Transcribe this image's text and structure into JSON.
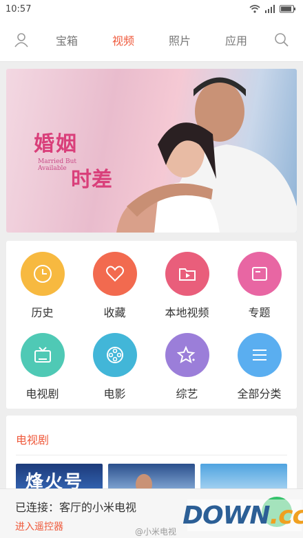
{
  "status_bar": {
    "time": "10:57",
    "icons": [
      "wifi-icon",
      "signal-icon",
      "battery-icon"
    ]
  },
  "top_nav": {
    "tabs": [
      {
        "label": "宝箱",
        "active": false
      },
      {
        "label": "视频",
        "active": true
      },
      {
        "label": "照片",
        "active": false
      },
      {
        "label": "应用",
        "active": false
      }
    ],
    "left_icon": "user-icon",
    "right_icon": "search-icon",
    "active_color": "#ef5a3c"
  },
  "banner": {
    "title_cn_1": "婚姻",
    "title_en_1": "Married But",
    "title_en_2": "Available",
    "title_cn_2": "时差"
  },
  "categories": [
    {
      "label": "历史",
      "icon": "clock-icon",
      "color": "#f7b940"
    },
    {
      "label": "收藏",
      "icon": "heart-icon",
      "color": "#f26a4f"
    },
    {
      "label": "本地视频",
      "icon": "folder-play-icon",
      "color": "#e95e7b"
    },
    {
      "label": "专题",
      "icon": "card-icon",
      "color": "#e866a3"
    },
    {
      "label": "电视剧",
      "icon": "tv-icon",
      "color": "#4fc9b5"
    },
    {
      "label": "电影",
      "icon": "film-reel-icon",
      "color": "#42b6d8"
    },
    {
      "label": "综艺",
      "icon": "stars-icon",
      "color": "#9b7ed9"
    },
    {
      "label": "全部分类",
      "icon": "menu-icon",
      "color": "#5aaef0"
    }
  ],
  "section": {
    "title": "电视剧",
    "posters": [
      {
        "text": "烽火号"
      },
      {
        "text": ""
      },
      {
        "text": ""
      }
    ]
  },
  "connection": {
    "status": "已连接：客厅的小米电视",
    "link": "进入遥控器"
  },
  "watermark": {
    "main": "DOWN",
    "suffix": ".cc",
    "weibo": "@小米电视"
  }
}
